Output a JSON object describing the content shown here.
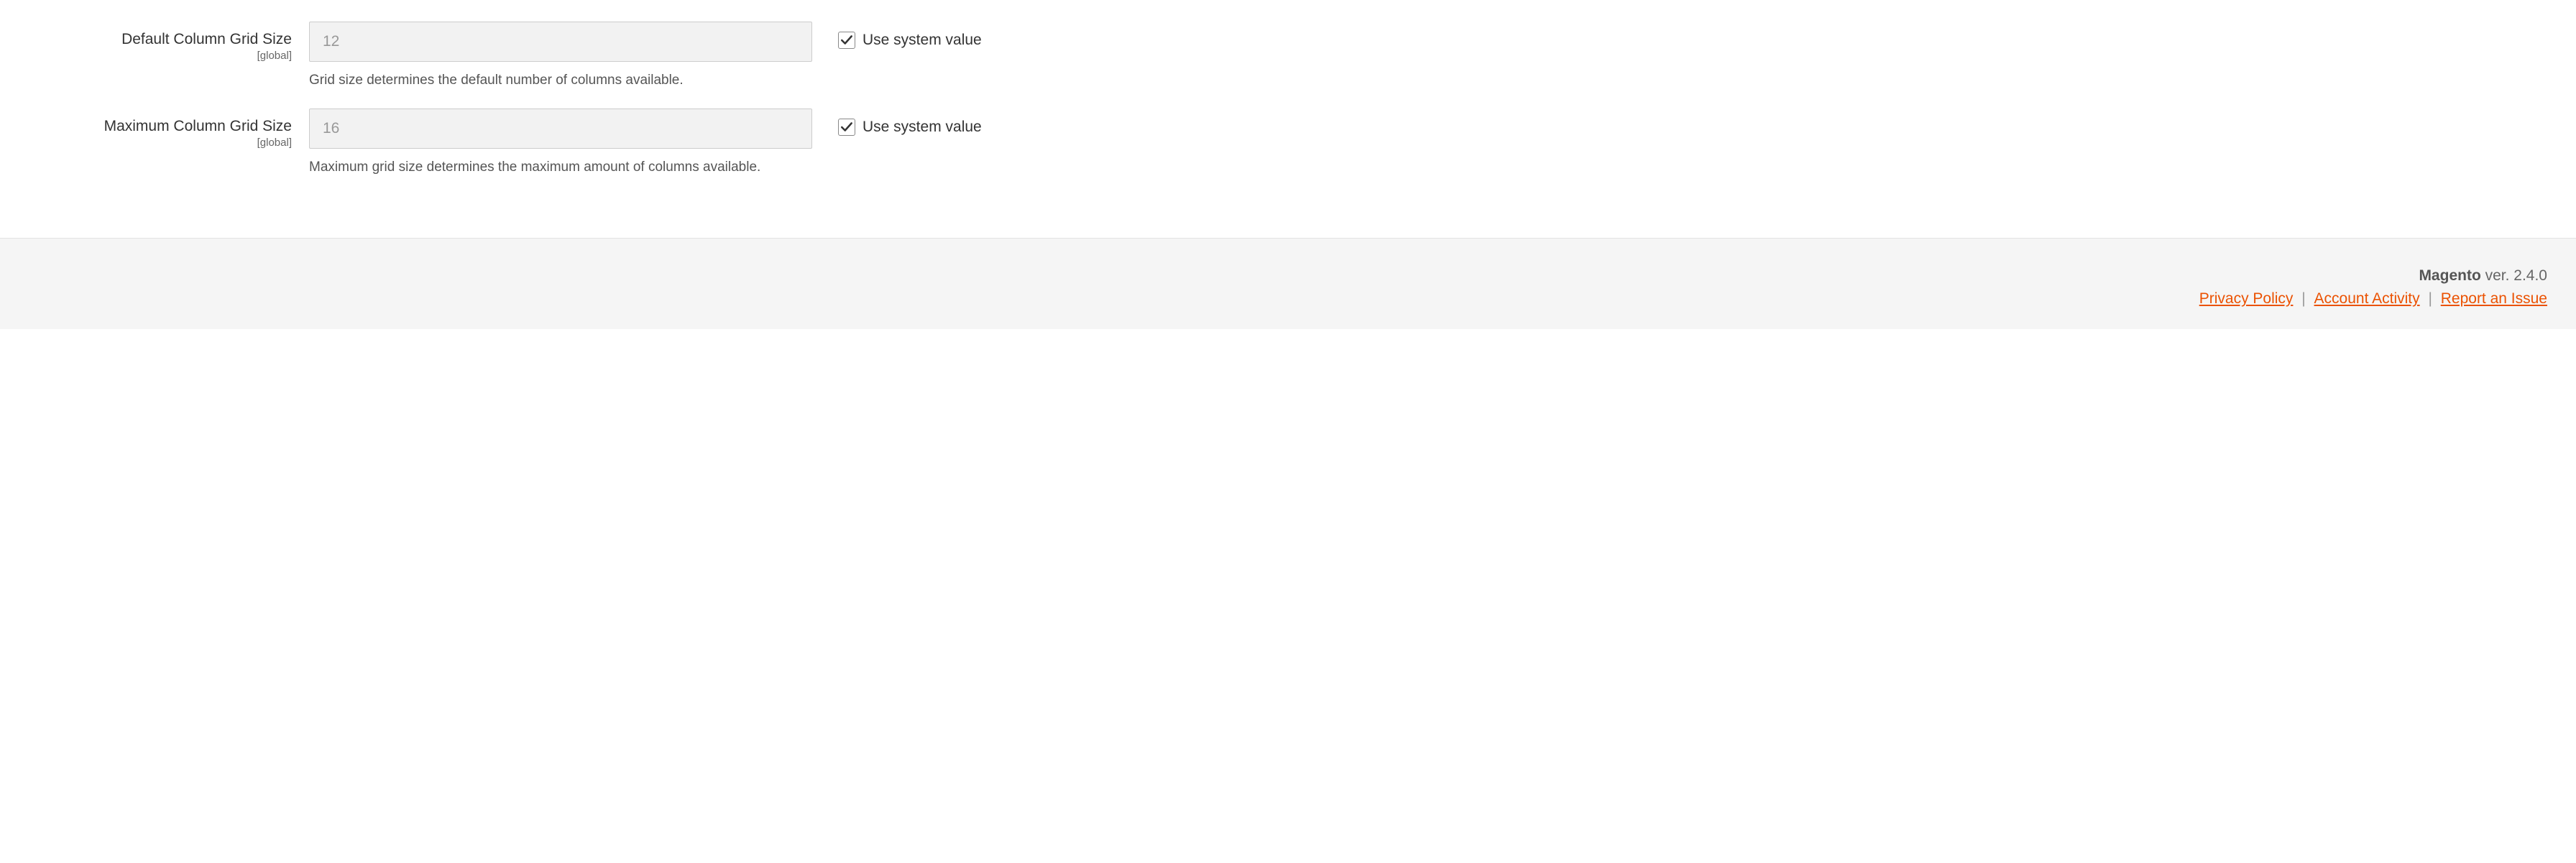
{
  "fields": {
    "default_grid": {
      "label": "Default Column Grid Size",
      "scope": "[global]",
      "value": "12",
      "help": "Grid size determines the default number of columns available.",
      "use_system_label": "Use system value"
    },
    "max_grid": {
      "label": "Maximum Column Grid Size",
      "scope": "[global]",
      "value": "16",
      "help": "Maximum grid size determines the maximum amount of columns available.",
      "use_system_label": "Use system value"
    }
  },
  "footer": {
    "brand": "Magento",
    "version_text": " ver. 2.4.0",
    "privacy": "Privacy Policy",
    "activity": " Account Activity",
    "report": "Report an Issue",
    "sep": " | "
  }
}
